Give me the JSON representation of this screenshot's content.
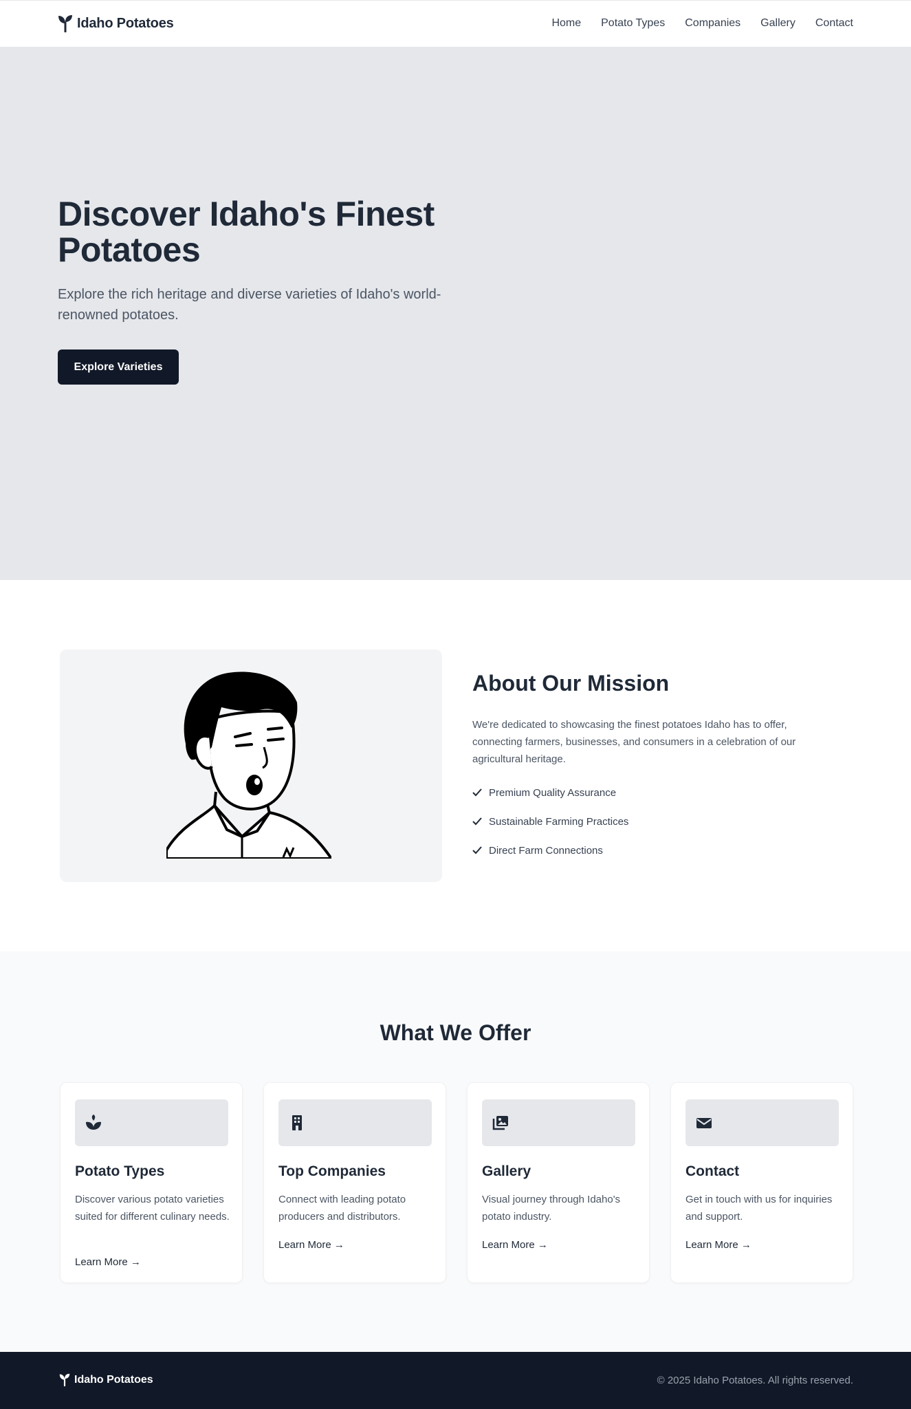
{
  "header": {
    "brand": "Idaho Potatoes",
    "nav": [
      "Home",
      "Potato Types",
      "Companies",
      "Gallery",
      "Contact"
    ]
  },
  "hero": {
    "title": "Discover Idaho's Finest Potatoes",
    "subtitle": "Explore the rich heritage and diverse varieties of Idaho's world-renowned potatoes.",
    "button": "Explore Varieties"
  },
  "mission": {
    "title": "About Our Mission",
    "text": "We're dedicated to showcasing the finest potatoes Idaho has to offer, connecting farmers, businesses, and consumers in a celebration of our agricultural heritage.",
    "features": [
      "Premium Quality Assurance",
      "Sustainable Farming Practices",
      "Direct Farm Connections"
    ]
  },
  "offer": {
    "title": "What We Offer",
    "cards": [
      {
        "icon": "seedling-icon",
        "title": "Potato Types",
        "desc": "Discover various potato varieties suited for different culinary needs.",
        "link": "Learn More →"
      },
      {
        "icon": "building-icon",
        "title": "Top Companies",
        "desc": "Connect with leading potato producers and distributors.",
        "link": "Learn More →"
      },
      {
        "icon": "images-icon",
        "title": "Gallery",
        "desc": "Visual journey through Idaho's potato industry.",
        "link": "Learn More →"
      },
      {
        "icon": "envelope-icon",
        "title": "Contact",
        "desc": "Get in touch with us for inquiries and support.",
        "link": "Learn More →"
      }
    ]
  },
  "footer": {
    "brand": "Idaho Potatoes",
    "copyright": "© 2025 Idaho Potatoes. All rights reserved."
  },
  "colors": {
    "dark": "#111827",
    "hero_bg": "#e5e7eb",
    "offer_bg": "#f9fafb",
    "text_muted": "#4b5563"
  }
}
